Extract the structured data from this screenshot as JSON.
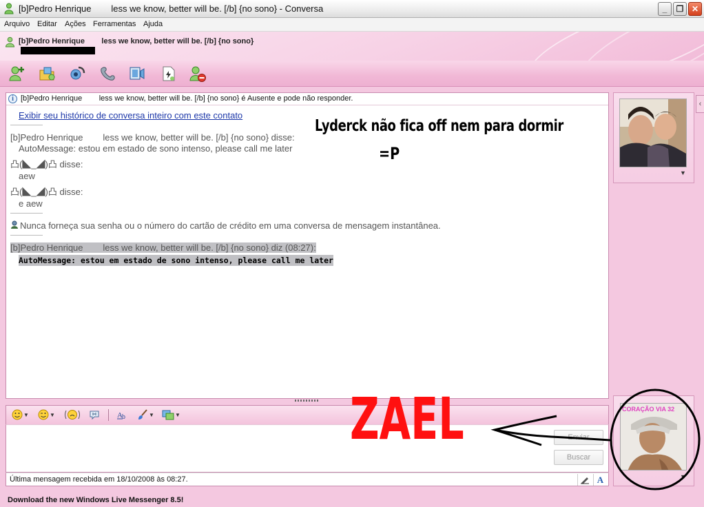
{
  "window": {
    "title": "[b]Pedro Henrique        less we know, better will be. [/b] {no sono} - Conversa",
    "controls": {
      "minimize": "_",
      "maximize": "❐",
      "close": "✕"
    }
  },
  "menu": {
    "items": [
      "Arquivo",
      "Editar",
      "Ações",
      "Ferramentas",
      "Ajuda"
    ]
  },
  "header": {
    "contact_name": "[b]Pedro Henrique        less we know, better will be. [/b] {no sono}"
  },
  "toolbar": {
    "icons": [
      "invite-contact-icon",
      "send-files-icon",
      "video-call-icon",
      "phone-call-icon",
      "activities-icon",
      "games-icon",
      "block-icon"
    ]
  },
  "conversation": {
    "status_line": "[b]Pedro Henrique        less we know, better will be. [/b] {no sono} é Ausente e pode não responder.",
    "history_link": "Exibir seu histórico de conversa inteiro com este contato",
    "messages": [
      {
        "sender": "[b]Pedro Henrique        less we know, better will be. [/b] {no sono} disse:",
        "text": "AutoMessage: estou em estado de sono intenso, please call me later"
      },
      {
        "sender": "凸(◣_◢)凸 disse:",
        "text": "aew"
      },
      {
        "sender": "凸(◣_◢)凸 disse:",
        "text": "e aew"
      }
    ],
    "security_note": "Nunca forneça sua senha ou o número do cartão de crédito em uma conversa de mensagem instantânea.",
    "last": {
      "sender": "[b]Pedro Henrique        less we know, better will be. [/b] {no sono} diz (08:27):",
      "text": "AutoMessage: estou em estado de sono intenso, please call me later"
    }
  },
  "annotations": {
    "caption_line1": "Lyderck não fica off nem para dormir",
    "caption_line2": "=P",
    "zael": "ZAEL",
    "photo_caption": "CORAÇÃO VIA 32",
    "colors": {
      "zael": "#ff1010",
      "circle": "#000000"
    }
  },
  "input": {
    "send_label": "Enviar",
    "search_label": "Buscar"
  },
  "statusbar": {
    "text": "Última mensagem recebida em 18/10/2008 às 08:27."
  },
  "footer": {
    "link": "Download the new Windows Live Messenger 8.5!"
  }
}
